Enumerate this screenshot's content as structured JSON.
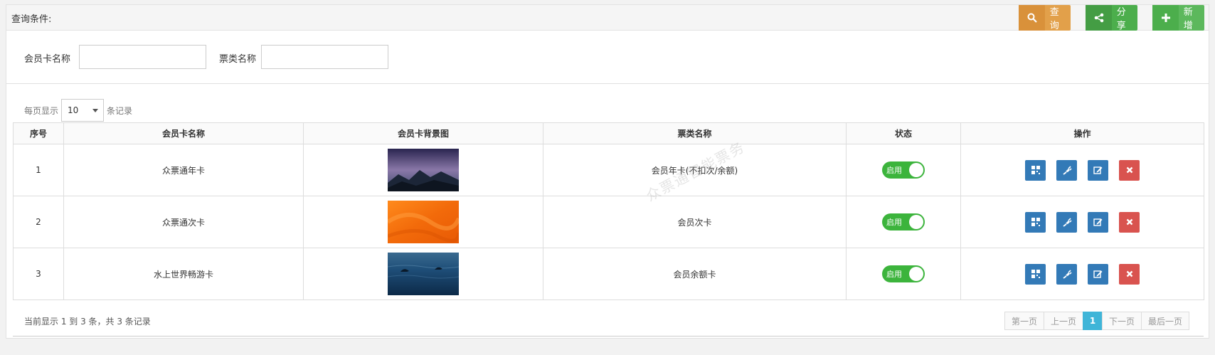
{
  "header": {
    "title": "查询条件:",
    "query_label": "查询",
    "share_label": "分享",
    "add_label": "新增"
  },
  "search": {
    "card_name_label": "会员卡名称",
    "ticket_name_label": "票类名称",
    "card_name_value": "",
    "ticket_name_value": ""
  },
  "page_size": {
    "prefix": "每页显示",
    "value": "10",
    "suffix": "条记录"
  },
  "table": {
    "headers": [
      "序号",
      "会员卡名称",
      "会员卡背景图",
      "票类名称",
      "状态",
      "操作"
    ],
    "rows": [
      {
        "index": "1",
        "card_name": "众票通年卡",
        "image": "night-mountains-image",
        "ticket_name": "会员年卡(不扣次/余额)",
        "status": "启用"
      },
      {
        "index": "2",
        "card_name": "众票通次卡",
        "image": "orange-sand-image",
        "ticket_name": "会员次卡",
        "status": "启用"
      },
      {
        "index": "3",
        "card_name": "水上世界畅游卡",
        "image": "ocean-dolphin-image",
        "ticket_name": "会员余额卡",
        "status": "启用"
      }
    ]
  },
  "footer": {
    "info": "当前显示 1 到 3 条，共 3 条记录"
  },
  "pager": {
    "first": "第一页",
    "prev": "上一页",
    "current": "1",
    "next": "下一页",
    "last": "最后一页"
  },
  "watermark": "众票通智能票务",
  "colors": {
    "query": "#e2a04a",
    "share": "#4cae4c",
    "add": "#5cb85c",
    "op_blue": "#337ab7",
    "op_red": "#d9534f",
    "toggle_on": "#3cb43c",
    "pager_active": "#3fb5d8"
  }
}
